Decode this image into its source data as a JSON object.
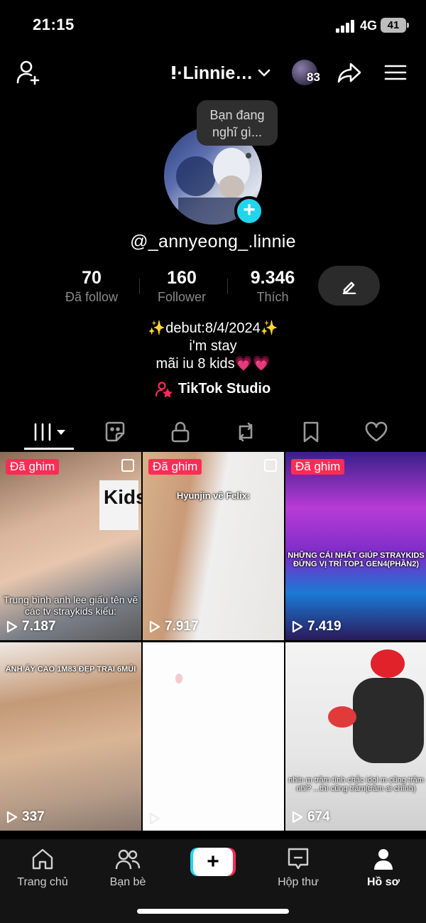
{
  "status_bar": {
    "time": "21:15",
    "network": "4G",
    "battery": "41"
  },
  "header": {
    "username": "ⵑ·Linnie…",
    "friend_count": "83"
  },
  "profile": {
    "bubble_text": "Bạn đang nghĩ gì...",
    "handle": "@_annyeong_.linnie",
    "stats": [
      {
        "value": "70",
        "label": "Đã follow"
      },
      {
        "value": "160",
        "label": "Follower"
      },
      {
        "value": "9.346",
        "label": "Thích"
      }
    ],
    "bio": [
      "✨debut:8/4/2024✨",
      "i'm stay",
      "mãi iu 8 kids💗💗"
    ],
    "studio_label": "TikTok Studio"
  },
  "tabs": [
    "videos",
    "reposts-sticker",
    "private",
    "repost",
    "saved",
    "liked"
  ],
  "videos": [
    {
      "pinned": "Đã ghim",
      "views": "7.187",
      "caption": "Trung bình anh lee giấu tên vẽ các tv straykids kiểu:"
    },
    {
      "pinned": "Đã ghim",
      "views": "7.917",
      "caption": "Hyunjin vẽ Felix:"
    },
    {
      "pinned": "Đã ghim",
      "views": "7.419",
      "caption": "NHỮNG CÁI NHẤT GIÚP STRAYKIDS ĐỨNG VỊ TRÍ TOP1 GEN4(PHẦN2)"
    },
    {
      "pinned": "",
      "views": "337",
      "caption": "ANH ẤY CAO 1M83 ĐẸP TRAI 6MÚI"
    },
    {
      "pinned": "",
      "views": "",
      "caption": ""
    },
    {
      "pinned": "",
      "views": "674",
      "caption": "nhìn m trầm tính chắc idol m cũng trầm nhỉ? ...thì cũng trầm(trầm ai chính)"
    }
  ],
  "bottom_nav": {
    "home": "Trang chủ",
    "friends": "Bạn bè",
    "inbox": "Hộp thư",
    "profile": "Hồ sơ"
  },
  "colors": {
    "accent": "#fe2c55",
    "cyan": "#20d5ec",
    "background": "#000000"
  }
}
